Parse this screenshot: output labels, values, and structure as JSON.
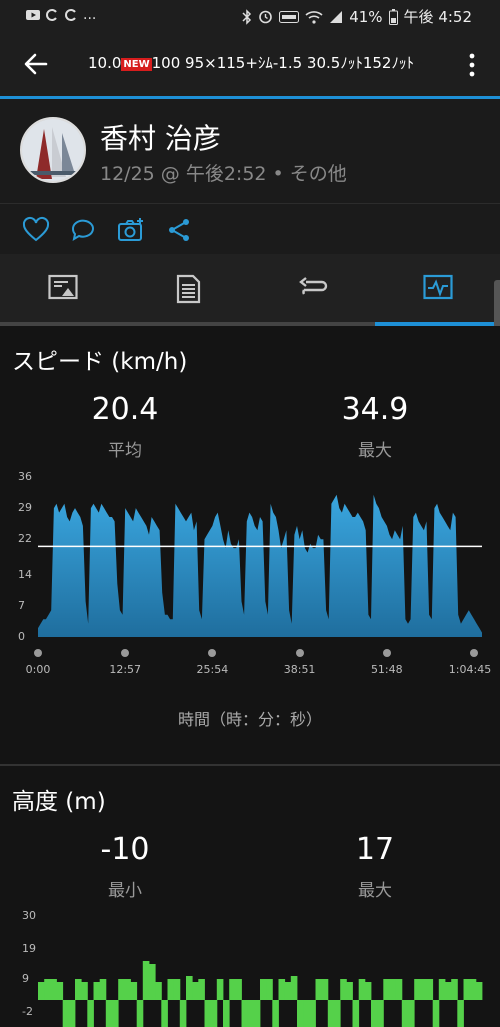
{
  "status": {
    "battery": "41%",
    "time": "午後 4:52",
    "dots": "..."
  },
  "header": {
    "title_pre": "10.0",
    "badge": "NEW",
    "title_post": "100 95×115+ｼﾑ-1.5  30.5ﾉｯﾄ152ﾉｯﾄ"
  },
  "profile": {
    "name": "香村 治彦",
    "subtitle": "12/25 @ 午後2:52 • その他"
  },
  "tabs": [
    "summary-icon",
    "laps-icon",
    "splits-icon",
    "chart-icon"
  ],
  "speed": {
    "title": "スピード (km/h)",
    "avg_value": "20.4",
    "avg_label": "平均",
    "max_value": "34.9",
    "max_label": "最大",
    "y_ticks": [
      "36",
      "29",
      "22",
      "14",
      "7",
      "0"
    ],
    "x_ticks": [
      "0:00",
      "12:57",
      "25:54",
      "38:51",
      "51:48",
      "1:04:45"
    ],
    "x_axis_title": "時間（時：分：秒）"
  },
  "elevation": {
    "title": "高度 (m)",
    "min_value": "-10",
    "min_label": "最小",
    "max_value": "17",
    "max_label": "最大",
    "y_ticks": [
      "30",
      "19",
      "9",
      "-2"
    ]
  },
  "chart_data": [
    {
      "type": "area",
      "title": "スピード (km/h)",
      "xlabel": "時間（時：分：秒）",
      "ylabel": "",
      "ylim": [
        0,
        36
      ],
      "x_ticks": [
        "0:00",
        "12:57",
        "25:54",
        "38:51",
        "51:48",
        "1:04:45"
      ],
      "avg_line": 20.4,
      "color": "#2b9bd6",
      "values": [
        2,
        3,
        4,
        4,
        5,
        6,
        29,
        30,
        28,
        29,
        30,
        27,
        26,
        28,
        29,
        28,
        27,
        25,
        8,
        3,
        29,
        30,
        29,
        28,
        30,
        29,
        28,
        27,
        27,
        26,
        12,
        6,
        5,
        29,
        28,
        27,
        26,
        29,
        28,
        27,
        26,
        25,
        23,
        27,
        26,
        25,
        24,
        10,
        5,
        5,
        4,
        4,
        30,
        29,
        28,
        27,
        26,
        27,
        28,
        24,
        26,
        6,
        4,
        22,
        23,
        24,
        25,
        27,
        28,
        25,
        22,
        20,
        24,
        21,
        20,
        20,
        22,
        8,
        5,
        26,
        28,
        27,
        25,
        24,
        27,
        26,
        8,
        5,
        30,
        28,
        27,
        24,
        20,
        22,
        24,
        6,
        3,
        23,
        25,
        22,
        24,
        20,
        19,
        21,
        20,
        20,
        23,
        22,
        22,
        6,
        4,
        30,
        31,
        32,
        29,
        28,
        30,
        29,
        28,
        27,
        27,
        28,
        27,
        26,
        24,
        5,
        4,
        32,
        30,
        29,
        27,
        26,
        25,
        23,
        22,
        24,
        23,
        22,
        25,
        4,
        3,
        4,
        27,
        28,
        26,
        25,
        24,
        26,
        5,
        4,
        29,
        30,
        28,
        27,
        26,
        25,
        24,
        28,
        27,
        5,
        3,
        4,
        5,
        6,
        5,
        4,
        3,
        2,
        1
      ],
      "series": [
        {
          "name": "",
          "values": []
        }
      ]
    },
    {
      "type": "area",
      "title": "高度 (m)",
      "xlabel": "",
      "ylabel": "",
      "ylim": [
        -2,
        30
      ],
      "color": "#55d14a",
      "values": [
        8,
        9,
        9,
        8,
        -8,
        -9,
        9,
        8,
        -7,
        8,
        9,
        -8,
        -9,
        9,
        9,
        8,
        -7,
        15,
        14,
        8,
        -8,
        9,
        9,
        -9,
        10,
        8,
        9,
        -8,
        -9,
        9,
        -9,
        9,
        9,
        -8,
        -9,
        -9,
        9,
        9,
        -8,
        9,
        8,
        10,
        -9,
        -9,
        -8,
        9,
        9,
        -9,
        -9,
        9,
        8,
        -8,
        9,
        8,
        -8,
        -9,
        9,
        9,
        9,
        -8,
        -9,
        9,
        9,
        9,
        -8,
        9,
        8,
        9,
        -9,
        9,
        9,
        8
      ]
    }
  ]
}
